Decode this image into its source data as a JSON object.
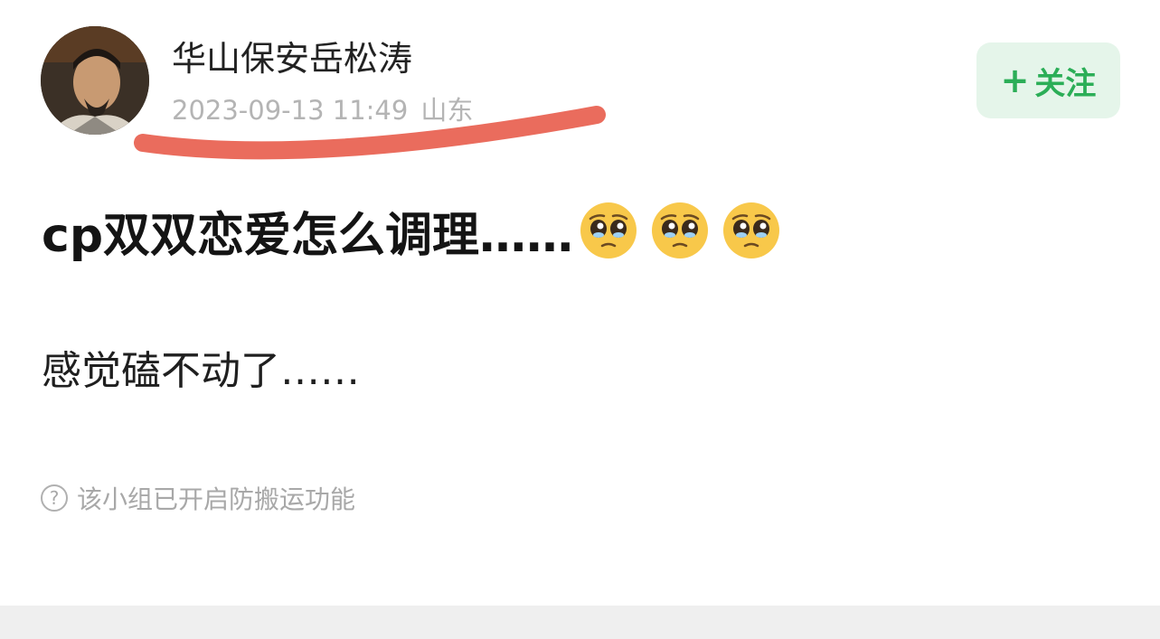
{
  "author": {
    "name": "华山保安岳松涛",
    "date": "2023-09-13 11:49",
    "location": "山东"
  },
  "follow_button": {
    "plus": "+",
    "label": "关注"
  },
  "post": {
    "title": "cp双双恋爱怎么调理……",
    "title_emoji": [
      "pleading-face",
      "pleading-face",
      "pleading-face"
    ],
    "body": "感觉磕不动了……"
  },
  "notice": {
    "icon": "?",
    "text": "该小组已开启防搬运功能"
  },
  "colors": {
    "accent_green": "#2bae57",
    "follow_bg": "#e5f5ea",
    "underline_red": "#e8604f",
    "meta_gray": "#b4b4b4"
  }
}
